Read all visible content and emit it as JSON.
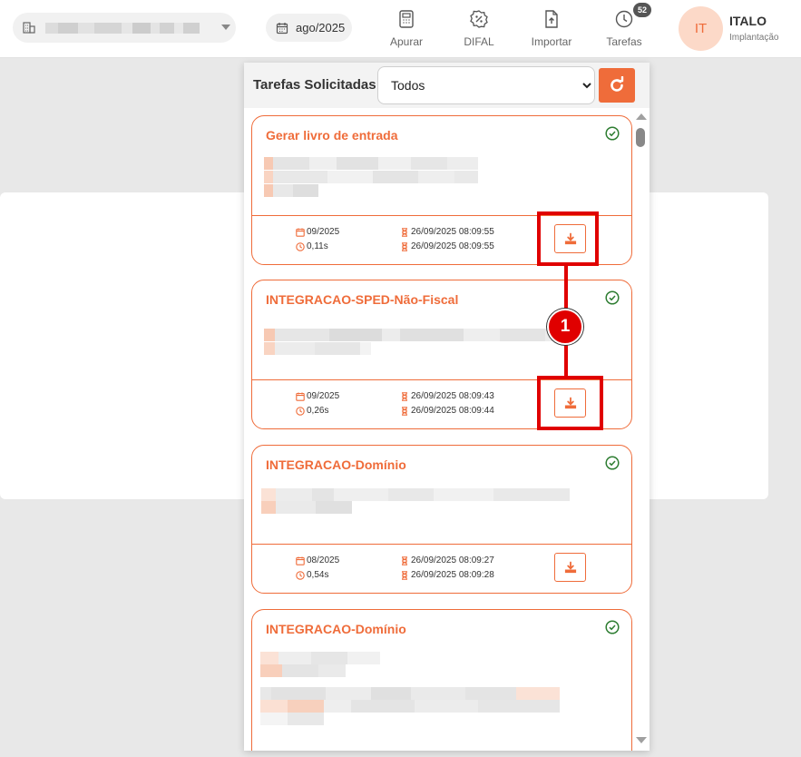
{
  "topbar": {
    "company_select": {
      "icon": "building-icon",
      "caret_icon": "chevron-down-icon"
    },
    "period": {
      "icon": "calendar-icon",
      "value": "ago/2025"
    },
    "nav": [
      {
        "label": "Apurar",
        "icon": "calculator-icon"
      },
      {
        "label": "DIFAL",
        "icon": "percent-badge-icon"
      },
      {
        "label": "Importar",
        "icon": "file-upload-icon"
      },
      {
        "label": "Tarefas",
        "icon": "clock-icon",
        "badge": "52"
      }
    ],
    "user": {
      "initials": "IT",
      "name": "ITALO",
      "role": "Implantação"
    }
  },
  "tasks_panel": {
    "title": "Tarefas Solicitadas",
    "filter": {
      "selected": "Todos"
    },
    "refresh_icon": "refresh-icon",
    "cards": [
      {
        "title": "Gerar livro de entrada",
        "period": "09/2025",
        "duration": "0,11s",
        "start": "26/09/2025 08:09:55",
        "end": "26/09/2025 08:09:55",
        "status_icon": "check-circle-icon",
        "download_icon": "download-icon"
      },
      {
        "title": "INTEGRACAO-SPED-Não-Fiscal",
        "period": "09/2025",
        "duration": "0,26s",
        "start": "26/09/2025 08:09:43",
        "end": "26/09/2025 08:09:44",
        "status_icon": "check-circle-icon",
        "download_icon": "download-icon"
      },
      {
        "title": "INTEGRACAO-Domínio",
        "period": "08/2025",
        "duration": "0,54s",
        "start": "26/09/2025 08:09:27",
        "end": "26/09/2025 08:09:28",
        "status_icon": "check-circle-icon",
        "download_icon": "download-icon"
      },
      {
        "title": "INTEGRACAO-Domínio",
        "status_icon": "check-circle-icon"
      }
    ]
  },
  "annotation": {
    "marker": "1",
    "color": "#e00000"
  },
  "colors": {
    "accent": "#ef6c3a",
    "success": "#2e7d32"
  }
}
